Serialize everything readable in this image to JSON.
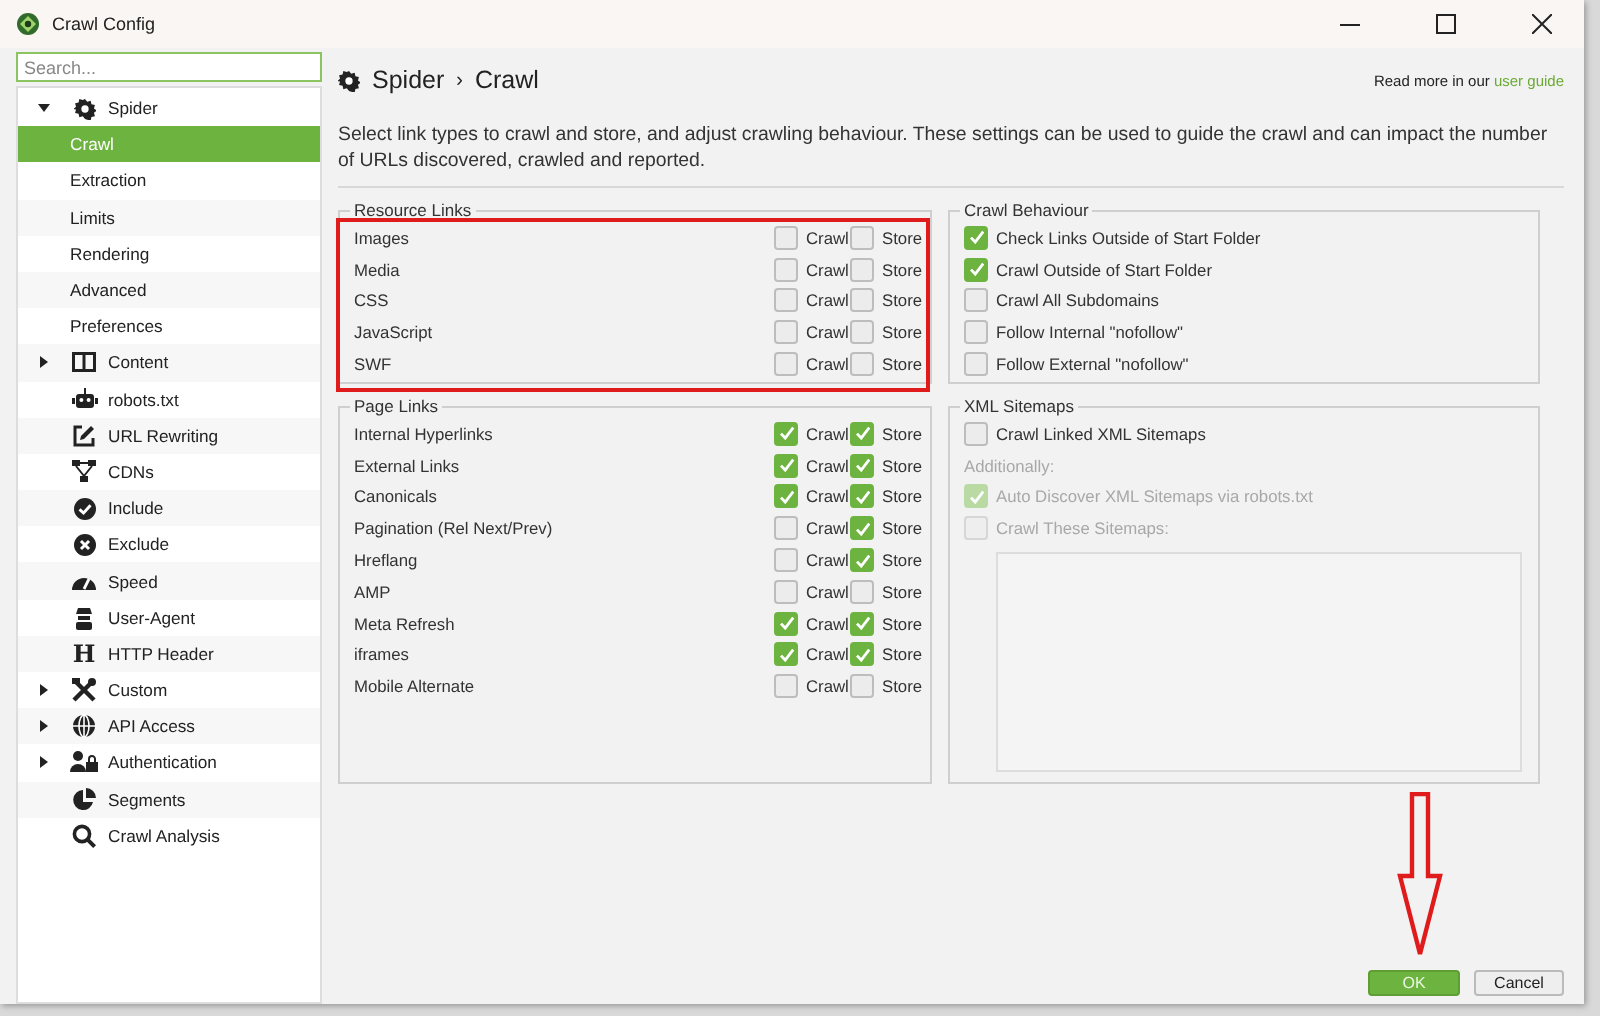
{
  "window": {
    "title": "Crawl Config"
  },
  "sidebar": {
    "search": {
      "placeholder": "Search..."
    },
    "items": [
      {
        "label": "Spider",
        "expanded": true,
        "selected": false,
        "children": [
          {
            "label": "Crawl",
            "selected": true
          },
          {
            "label": "Extraction",
            "selected": false
          },
          {
            "label": "Limits",
            "selected": false
          },
          {
            "label": "Rendering",
            "selected": false
          },
          {
            "label": "Advanced",
            "selected": false
          },
          {
            "label": "Preferences",
            "selected": false
          }
        ]
      },
      {
        "label": "Content",
        "expanded": false,
        "selected": false
      },
      {
        "label": "robots.txt",
        "selected": false
      },
      {
        "label": "URL Rewriting",
        "selected": false
      },
      {
        "label": "CDNs",
        "selected": false
      },
      {
        "label": "Include",
        "selected": false
      },
      {
        "label": "Exclude",
        "selected": false
      },
      {
        "label": "Speed",
        "selected": false
      },
      {
        "label": "User-Agent",
        "selected": false
      },
      {
        "label": "HTTP Header",
        "glyph": "H",
        "selected": false
      },
      {
        "label": "Custom",
        "expanded": false,
        "selected": false
      },
      {
        "label": "API Access",
        "expanded": false,
        "selected": false
      },
      {
        "label": "Authentication",
        "expanded": false,
        "selected": false
      },
      {
        "label": "Segments",
        "selected": false
      },
      {
        "label": "Crawl Analysis",
        "selected": false
      }
    ]
  },
  "header": {
    "breadcrumb": [
      "Spider",
      "Crawl"
    ],
    "separator": "›",
    "help_text": "Read more in our",
    "help_link": "user guide"
  },
  "description": "Select link types to crawl and store, and adjust crawling behaviour. These settings can be used to guide the crawl and can impact the number of URLs discovered, crawled and reported.",
  "resource_links": {
    "title": "Resource Links",
    "rows": [
      {
        "label": "Images",
        "crawl": {
          "label": "Crawl",
          "checked": false
        },
        "store": {
          "label": "Store",
          "checked": false
        }
      },
      {
        "label": "Media",
        "crawl": {
          "label": "Crawl",
          "checked": false
        },
        "store": {
          "label": "Store",
          "checked": false
        }
      },
      {
        "label": "CSS",
        "crawl": {
          "label": "Crawl",
          "checked": false
        },
        "store": {
          "label": "Store",
          "checked": false
        }
      },
      {
        "label": "JavaScript",
        "crawl": {
          "label": "Crawl",
          "checked": false
        },
        "store": {
          "label": "Store",
          "checked": false
        }
      },
      {
        "label": "SWF",
        "crawl": {
          "label": "Crawl",
          "checked": false
        },
        "store": {
          "label": "Store",
          "checked": false
        }
      }
    ]
  },
  "crawl_behaviour": {
    "title": "Crawl Behaviour",
    "items": [
      {
        "kind": "checkbox",
        "label": "Check Links Outside of Start Folder",
        "checked": true,
        "disabled": false
      },
      {
        "kind": "checkbox",
        "label": "Crawl Outside of Start Folder",
        "checked": true,
        "disabled": false
      },
      {
        "kind": "checkbox",
        "label": "Crawl All Subdomains",
        "checked": false,
        "disabled": false
      },
      {
        "kind": "checkbox",
        "label": "Follow Internal \"nofollow\"",
        "checked": false,
        "disabled": false
      },
      {
        "kind": "checkbox",
        "label": "Follow External \"nofollow\"",
        "checked": false,
        "disabled": false
      }
    ]
  },
  "page_links": {
    "title": "Page Links",
    "rows": [
      {
        "label": "Internal Hyperlinks",
        "crawl": {
          "label": "Crawl",
          "checked": true
        },
        "store": {
          "label": "Store",
          "checked": true
        }
      },
      {
        "label": "External Links",
        "crawl": {
          "label": "Crawl",
          "checked": true
        },
        "store": {
          "label": "Store",
          "checked": true
        }
      },
      {
        "label": "Canonicals",
        "crawl": {
          "label": "Crawl",
          "checked": true
        },
        "store": {
          "label": "Store",
          "checked": true
        }
      },
      {
        "label": "Pagination (Rel Next/Prev)",
        "crawl": {
          "label": "Crawl",
          "checked": false
        },
        "store": {
          "label": "Store",
          "checked": true
        }
      },
      {
        "label": "Hreflang",
        "crawl": {
          "label": "Crawl",
          "checked": false
        },
        "store": {
          "label": "Store",
          "checked": true
        }
      },
      {
        "label": "AMP",
        "crawl": {
          "label": "Crawl",
          "checked": false
        },
        "store": {
          "label": "Store",
          "checked": false
        }
      },
      {
        "label": "Meta Refresh",
        "crawl": {
          "label": "Crawl",
          "checked": true
        },
        "store": {
          "label": "Store",
          "checked": true
        }
      },
      {
        "label": "iframes",
        "crawl": {
          "label": "Crawl",
          "checked": true
        },
        "store": {
          "label": "Store",
          "checked": true
        }
      },
      {
        "label": "Mobile Alternate",
        "crawl": {
          "label": "Crawl",
          "checked": false
        },
        "store": {
          "label": "Store",
          "checked": false
        }
      }
    ]
  },
  "xml_sitemaps": {
    "title": "XML Sitemaps",
    "items": [
      {
        "kind": "checkbox",
        "label": "Crawl Linked XML Sitemaps",
        "checked": false,
        "disabled": false
      },
      {
        "kind": "note",
        "label": "Additionally:",
        "disabled": true
      },
      {
        "kind": "checkbox",
        "label": "Auto Discover XML Sitemaps via robots.txt",
        "checked": true,
        "disabled": true
      },
      {
        "kind": "checkbox",
        "label": "Crawl These Sitemaps:",
        "checked": false,
        "disabled": true
      },
      {
        "kind": "textarea",
        "disabled": true
      }
    ]
  },
  "buttons": [
    {
      "label": "OK",
      "kind": "primary"
    },
    {
      "label": "Cancel",
      "kind": "secondary"
    }
  ]
}
